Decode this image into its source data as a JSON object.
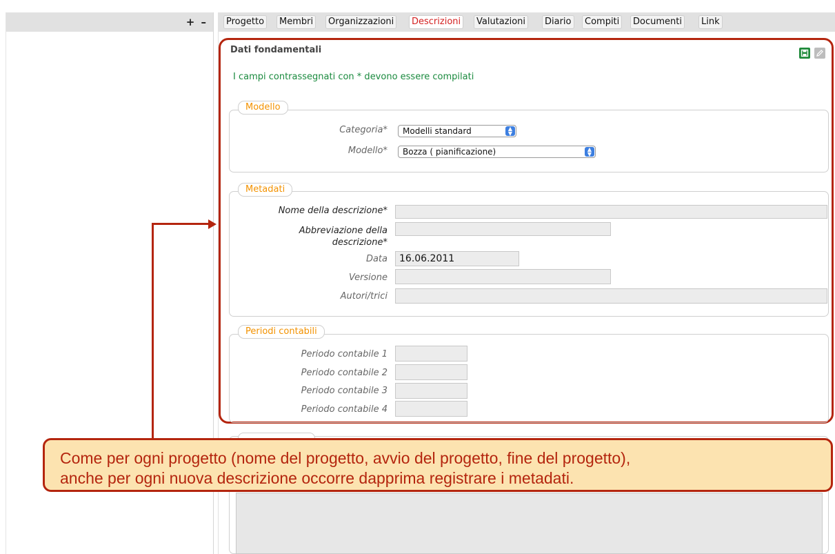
{
  "sidebar": {
    "controls": "+ –"
  },
  "tabs": [
    {
      "label": "Progetto"
    },
    {
      "label": "Membri"
    },
    {
      "label": "Organizzazioni"
    },
    {
      "label": "Descrizioni",
      "active": true
    },
    {
      "label": "Valutazioni"
    },
    {
      "label": "Diario"
    },
    {
      "label": "Compiti"
    },
    {
      "label": "Documenti"
    },
    {
      "label": "Link"
    }
  ],
  "main": {
    "title": "Dati fondamentali",
    "required_note": "I campi contrassegnati con * devono essere compilati",
    "save_icon": "save-icon",
    "edit_icon": "pencil-icon"
  },
  "modello": {
    "legend": "Modello",
    "categoria_label": "Categoria*",
    "categoria_value": "Modelli standard",
    "modello_label": "Modello*",
    "modello_value": "Bozza ( pianificazione)"
  },
  "metadati": {
    "legend": "Metadati",
    "nome_label": "Nome della descrizione*",
    "abbrev_label_1": "Abbreviazione della",
    "abbrev_label_2": "descrizione*",
    "data_label": "Data",
    "data_value": "16.06.2011",
    "versione_label": "Versione",
    "autori_label": "Autori/trici"
  },
  "periodi": {
    "legend": "Periodi contabili",
    "p1": "Periodo contabile 1",
    "p2": "Periodo contabile 2",
    "p3": "Periodo contabile 3",
    "p4": "Periodo contabile 4"
  },
  "callout": {
    "line1": "Come per ogni progetto (nome del progetto, avvio del progetto, fine del progetto),",
    "line2": "anche per ogni nuova descrizione occorre dapprima registrare i metadati."
  },
  "colors": {
    "accent_red": "#b4250e",
    "legend_orange": "#f39200",
    "note_green": "#1a8a3e",
    "callout_bg": "#fce3b0"
  }
}
